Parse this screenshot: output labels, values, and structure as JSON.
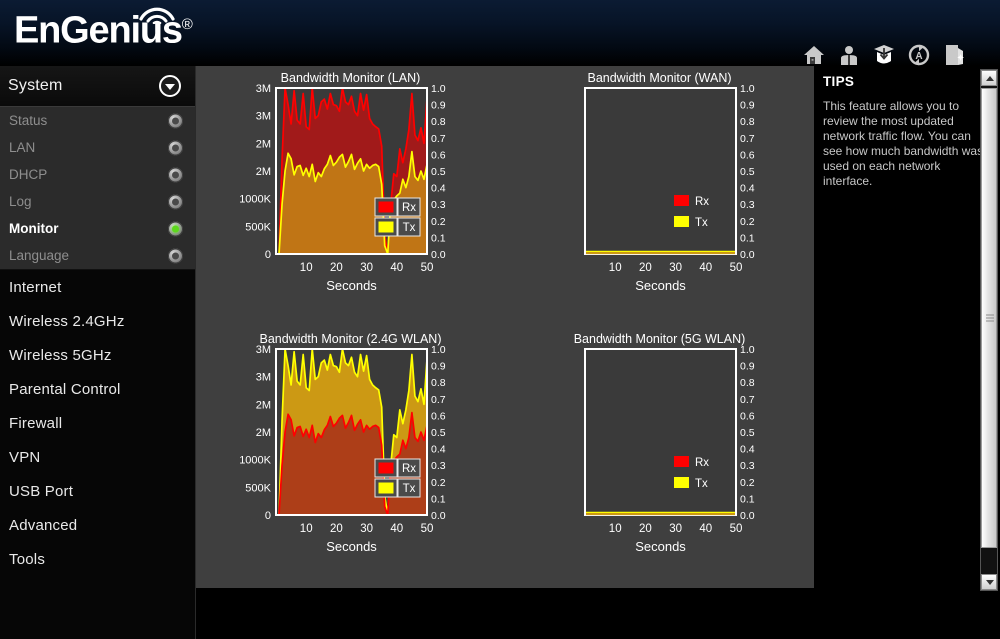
{
  "header": {
    "brand": "EnGenius",
    "registered_mark": "®",
    "wifi_icon": "wifi-arc-icon",
    "toolbar": [
      {
        "name": "home-icon",
        "label": "Home"
      },
      {
        "name": "user-icon",
        "label": "User"
      },
      {
        "name": "wizard-icon",
        "label": "Wizard"
      },
      {
        "name": "auto-refresh-icon",
        "label": "Auto Refresh"
      },
      {
        "name": "logout-icon",
        "label": "Logout"
      }
    ]
  },
  "sidebar": {
    "section_title": "System",
    "collapse_icon": "chevron-down-icon",
    "submenu": [
      {
        "label": "Status",
        "active": false
      },
      {
        "label": "LAN",
        "active": false
      },
      {
        "label": "DHCP",
        "active": false
      },
      {
        "label": "Log",
        "active": false
      },
      {
        "label": "Monitor",
        "active": true
      },
      {
        "label": "Language",
        "active": false
      }
    ],
    "menu": [
      {
        "label": "Internet"
      },
      {
        "label": "Wireless 2.4GHz"
      },
      {
        "label": "Wireless 5GHz"
      },
      {
        "label": "Parental Control"
      },
      {
        "label": "Firewall"
      },
      {
        "label": "VPN"
      },
      {
        "label": "USB Port"
      },
      {
        "label": "Advanced"
      },
      {
        "label": "Tools"
      }
    ]
  },
  "tips": {
    "title": "TIPS",
    "body": "This feature allows you to review the most updated network traffic flow. You can see how much bandwidth was used on each network interface.",
    "scrollbar": {
      "up_icon": "scroll-up-arrow-icon",
      "down_icon": "scroll-down-arrow-icon",
      "grip_icon": "scroll-grip-icon"
    }
  },
  "colors": {
    "rx_stroke": "#ff0000",
    "rx_fill": "#a11a1a",
    "tx_stroke": "#ffff00",
    "tx_fill": "#cc9914",
    "tx_fill_over_rx": "#8f8f20",
    "plot_bg": "#3a3a3a",
    "panel_bg": "#3f3f3f",
    "axis": "#ffffff",
    "accent_green": "#5dd81c"
  },
  "chart_data": [
    {
      "type": "area",
      "id": "lan",
      "title": "Bandwidth Monitor (LAN)",
      "xlabel": "Seconds",
      "ylabel": "",
      "xlim": [
        0,
        50
      ],
      "xticks": [
        10,
        20,
        30,
        40,
        50
      ],
      "left_axis": {
        "ticks": [
          0,
          500000,
          1000000,
          1500000,
          2000000,
          2500000,
          3000000
        ],
        "ticklabels": [
          "0",
          "500K",
          "1000K",
          "2M",
          "2M",
          "3M",
          "3M"
        ],
        "ylim": [
          0,
          3000000
        ]
      },
      "right_axis": {
        "ticks": [
          0.0,
          0.1,
          0.2,
          0.3,
          0.4,
          0.5,
          0.6,
          0.7,
          0.8,
          0.9,
          1.0
        ],
        "ticklabels": [
          "0.0",
          "0.1",
          "0.2",
          "0.3",
          "0.4",
          "0.5",
          "0.6",
          "0.7",
          "0.8",
          "0.9",
          "1.0"
        ],
        "ylim": [
          0,
          1.0
        ]
      },
      "grid": false,
      "legend": {
        "position": "lower-right",
        "boxed": true,
        "entries": [
          {
            "label": "Rx",
            "color": "#ff0000"
          },
          {
            "label": "Tx",
            "color": "#ffff00"
          }
        ]
      },
      "x": [
        1,
        2,
        3,
        4,
        5,
        6,
        7,
        8,
        9,
        10,
        11,
        12,
        13,
        14,
        15,
        16,
        17,
        18,
        19,
        20,
        21,
        22,
        23,
        24,
        25,
        26,
        27,
        28,
        29,
        30,
        31,
        32,
        33,
        34,
        35,
        36,
        37,
        38,
        39,
        40,
        41,
        42,
        43,
        44,
        45,
        46,
        47,
        48,
        49,
        50
      ],
      "series": [
        {
          "name": "Rx",
          "color": "#ff0000",
          "values": [
            0,
            1700000,
            3100000,
            2700000,
            2350000,
            2950000,
            2420000,
            2350000,
            2900000,
            2300000,
            2250000,
            3000000,
            2450000,
            2500000,
            2750000,
            2800000,
            2620000,
            2900000,
            2700000,
            2680000,
            2580000,
            3100000,
            2750000,
            2700000,
            2850000,
            2580000,
            2500000,
            2900000,
            2600000,
            2880000,
            2450000,
            2350000,
            2300000,
            2260000,
            1950000,
            350000,
            0,
            900000,
            1450000,
            1400000,
            1900000,
            1650000,
            1900000,
            2250000,
            2900000,
            2150000,
            2050000,
            2280000,
            2000000,
            2820000
          ]
        },
        {
          "name": "Tx",
          "color": "#ffff00",
          "values": [
            0,
            900000,
            1500000,
            1820000,
            1720000,
            1430000,
            1580000,
            1600000,
            1420000,
            1550000,
            1400000,
            1620000,
            1310000,
            1470000,
            1400000,
            1540000,
            1620000,
            1780000,
            1600000,
            1660000,
            1750000,
            1800000,
            1570000,
            1670000,
            1800000,
            1530000,
            1640000,
            1720000,
            1500000,
            1620000,
            1550000,
            1600000,
            1620000,
            1580000,
            1260000,
            150000,
            0,
            950000,
            980000,
            1050000,
            1100000,
            1350000,
            1200000,
            1400000,
            1850000,
            1400000,
            1330000,
            1500000,
            1350000,
            1620000
          ]
        }
      ]
    },
    {
      "type": "area",
      "id": "wan",
      "title": "Bandwidth Monitor (WAN)",
      "xlabel": "Seconds",
      "ylabel": "",
      "xlim": [
        0,
        50
      ],
      "xticks": [
        10,
        20,
        30,
        40,
        50
      ],
      "left_axis": {
        "ticks": [],
        "ticklabels": [],
        "ylim": [
          0,
          1.0
        ]
      },
      "right_axis": {
        "ticks": [
          0.0,
          0.1,
          0.2,
          0.3,
          0.4,
          0.5,
          0.6,
          0.7,
          0.8,
          0.9,
          1.0
        ],
        "ticklabels": [
          "0.0",
          "0.1",
          "0.2",
          "0.3",
          "0.4",
          "0.5",
          "0.6",
          "0.7",
          "0.8",
          "0.9",
          "1.0"
        ],
        "ylim": [
          0,
          1.0
        ]
      },
      "grid": false,
      "legend": {
        "position": "lower-right",
        "boxed": false,
        "entries": [
          {
            "label": "Rx",
            "color": "#ff0000"
          },
          {
            "label": "Tx",
            "color": "#ffff00"
          }
        ]
      },
      "x": [
        0,
        50
      ],
      "series": [
        {
          "name": "Rx",
          "color": "#ff0000",
          "values": [
            0,
            0
          ]
        },
        {
          "name": "Tx",
          "color": "#ffff00",
          "values": [
            0,
            0
          ]
        }
      ]
    },
    {
      "type": "area",
      "id": "wlan24",
      "title": "Bandwidth Monitor (2.4G WLAN)",
      "xlabel": "Seconds",
      "ylabel": "",
      "xlim": [
        0,
        50
      ],
      "xticks": [
        10,
        20,
        30,
        40,
        50
      ],
      "left_axis": {
        "ticks": [
          0,
          500000,
          1000000,
          1500000,
          2000000,
          2500000,
          3000000
        ],
        "ticklabels": [
          "0",
          "500K",
          "1000K",
          "2M",
          "2M",
          "3M",
          "3M"
        ],
        "ylim": [
          0,
          3000000
        ]
      },
      "right_axis": {
        "ticks": [
          0.0,
          0.1,
          0.2,
          0.3,
          0.4,
          0.5,
          0.6,
          0.7,
          0.8,
          0.9,
          1.0
        ],
        "ticklabels": [
          "0.0",
          "0.1",
          "0.2",
          "0.3",
          "0.4",
          "0.5",
          "0.6",
          "0.7",
          "0.8",
          "0.9",
          "1.0"
        ],
        "ylim": [
          0,
          1.0
        ]
      },
      "grid": false,
      "legend": {
        "position": "lower-right",
        "boxed": true,
        "entries": [
          {
            "label": "Rx",
            "color": "#ff0000"
          },
          {
            "label": "Tx",
            "color": "#ffff00"
          }
        ]
      },
      "x": [
        1,
        2,
        3,
        4,
        5,
        6,
        7,
        8,
        9,
        10,
        11,
        12,
        13,
        14,
        15,
        16,
        17,
        18,
        19,
        20,
        21,
        22,
        23,
        24,
        25,
        26,
        27,
        28,
        29,
        30,
        31,
        32,
        33,
        34,
        35,
        36,
        37,
        38,
        39,
        40,
        41,
        42,
        43,
        44,
        45,
        46,
        47,
        48,
        49,
        50
      ],
      "series": [
        {
          "name": "Rx",
          "color": "#ff0000",
          "values": [
            0,
            900000,
            1500000,
            1820000,
            1720000,
            1430000,
            1580000,
            1600000,
            1420000,
            1550000,
            1400000,
            1620000,
            1310000,
            1470000,
            1400000,
            1540000,
            1620000,
            1780000,
            1600000,
            1660000,
            1750000,
            1800000,
            1570000,
            1670000,
            1800000,
            1530000,
            1640000,
            1720000,
            1500000,
            1620000,
            1550000,
            1600000,
            1620000,
            1580000,
            1260000,
            150000,
            0,
            950000,
            980000,
            1050000,
            1100000,
            1350000,
            1200000,
            1400000,
            1850000,
            1400000,
            1330000,
            1500000,
            1350000,
            1620000
          ]
        },
        {
          "name": "Tx",
          "color": "#ffff00",
          "values": [
            0,
            1700000,
            3100000,
            2700000,
            2350000,
            2950000,
            2420000,
            2350000,
            2900000,
            2300000,
            2250000,
            3000000,
            2450000,
            2500000,
            2750000,
            2800000,
            2620000,
            2900000,
            2700000,
            2680000,
            2580000,
            3100000,
            2750000,
            2700000,
            2850000,
            2580000,
            2500000,
            2900000,
            2600000,
            2880000,
            2450000,
            2350000,
            2300000,
            2260000,
            1950000,
            350000,
            0,
            900000,
            1450000,
            1400000,
            1900000,
            1650000,
            1900000,
            2250000,
            2900000,
            2150000,
            2050000,
            2280000,
            2000000,
            2820000
          ]
        }
      ]
    },
    {
      "type": "area",
      "id": "wlan5",
      "title": "Bandwidth Monitor (5G WLAN)",
      "xlabel": "Seconds",
      "ylabel": "",
      "xlim": [
        0,
        50
      ],
      "xticks": [
        10,
        20,
        30,
        40,
        50
      ],
      "left_axis": {
        "ticks": [],
        "ticklabels": [],
        "ylim": [
          0,
          1.0
        ]
      },
      "right_axis": {
        "ticks": [
          0.0,
          0.1,
          0.2,
          0.3,
          0.4,
          0.5,
          0.6,
          0.7,
          0.8,
          0.9,
          1.0
        ],
        "ticklabels": [
          "0.0",
          "0.1",
          "0.2",
          "0.3",
          "0.4",
          "0.5",
          "0.6",
          "0.7",
          "0.8",
          "0.9",
          "1.0"
        ],
        "ylim": [
          0,
          1.0
        ]
      },
      "grid": false,
      "legend": {
        "position": "lower-right",
        "boxed": false,
        "entries": [
          {
            "label": "Rx",
            "color": "#ff0000"
          },
          {
            "label": "Tx",
            "color": "#ffff00"
          }
        ]
      },
      "x": [
        0,
        50
      ],
      "series": [
        {
          "name": "Rx",
          "color": "#ff0000",
          "values": [
            0,
            0
          ]
        },
        {
          "name": "Tx",
          "color": "#ffff00",
          "values": [
            0,
            0
          ]
        }
      ]
    }
  ]
}
